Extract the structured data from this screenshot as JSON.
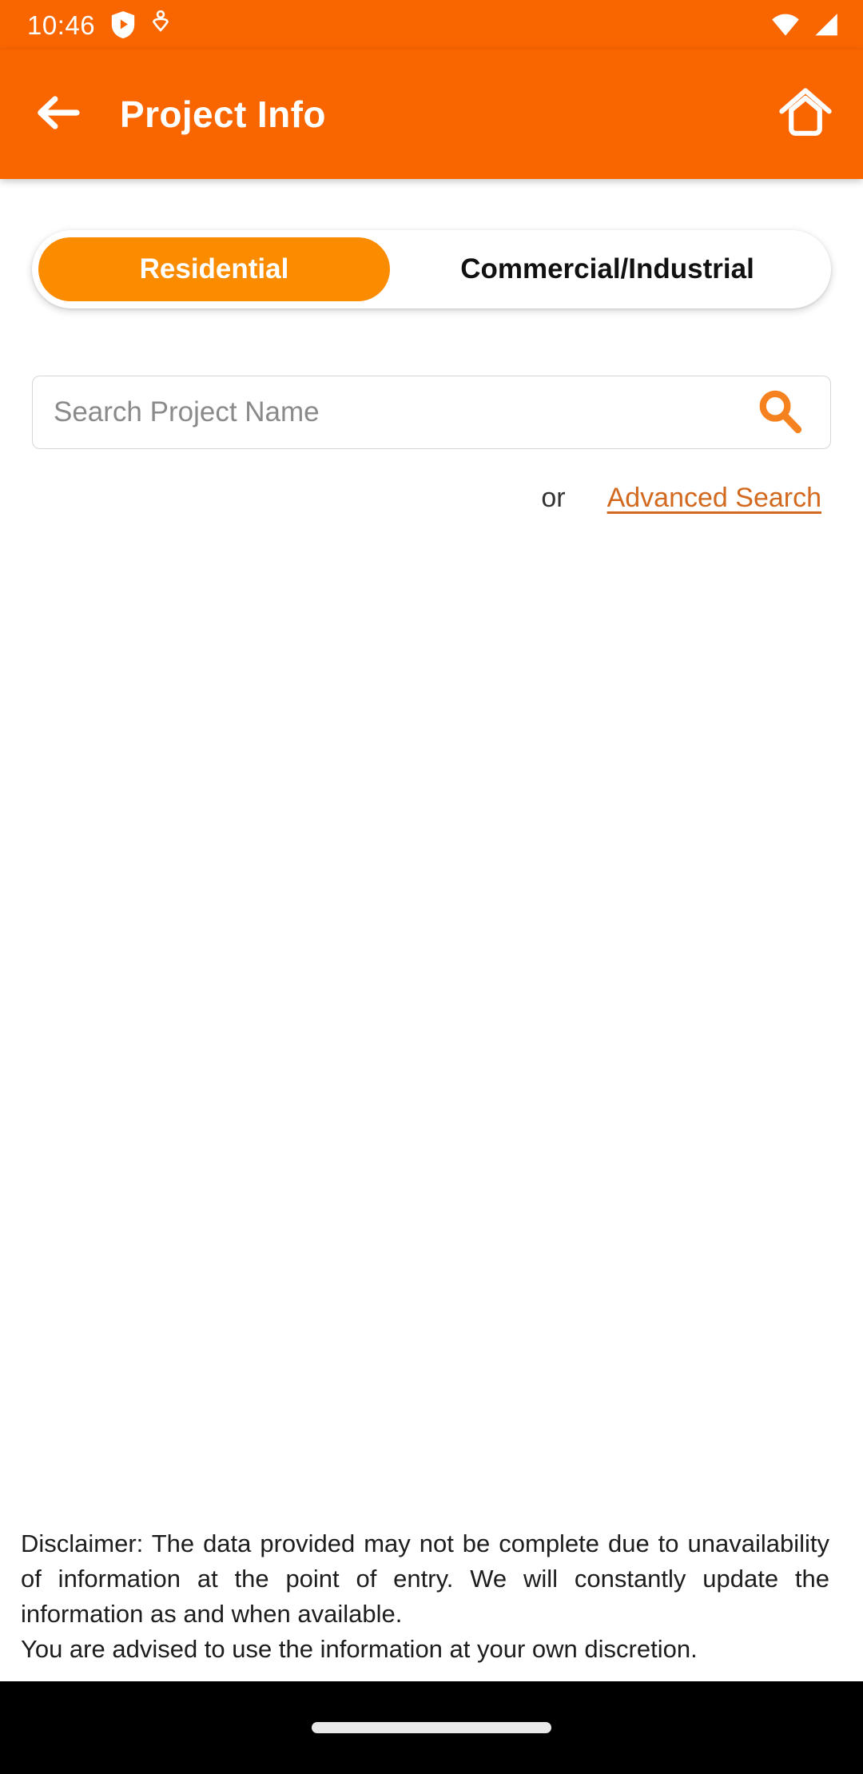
{
  "theme": {
    "brand_orange": "#F96600",
    "accent_orange": "#FB8C00",
    "link_orange": "#D2691E",
    "background": "#FFFFFF",
    "navbar": "#000000"
  },
  "status_bar": {
    "time": "10:46",
    "icons": [
      "play-protect-shield-icon",
      "accessibility-icon",
      "wifi-icon",
      "cellular-signal-icon"
    ]
  },
  "app_bar": {
    "title": "Project Info",
    "back_icon": "arrow-left-icon",
    "home_icon": "home-icon"
  },
  "tabs": {
    "selected": "Residential",
    "items": [
      {
        "label": "Residential",
        "active": true
      },
      {
        "label": "Commercial/Industrial",
        "active": false
      }
    ]
  },
  "search": {
    "placeholder": "Search Project Name",
    "value": "",
    "icon": "search-icon"
  },
  "alt_search": {
    "or_label": "or",
    "link_label": "Advanced Search"
  },
  "disclaimer": {
    "line1": "Disclaimer: The data provided may not be complete due to unavailability of information at the point of entry. We will constantly update the information as and when available.",
    "line2": "You are advised to use the information at your own discretion."
  },
  "nav_bar": {
    "home_indicator": "home-indicator-pill"
  }
}
